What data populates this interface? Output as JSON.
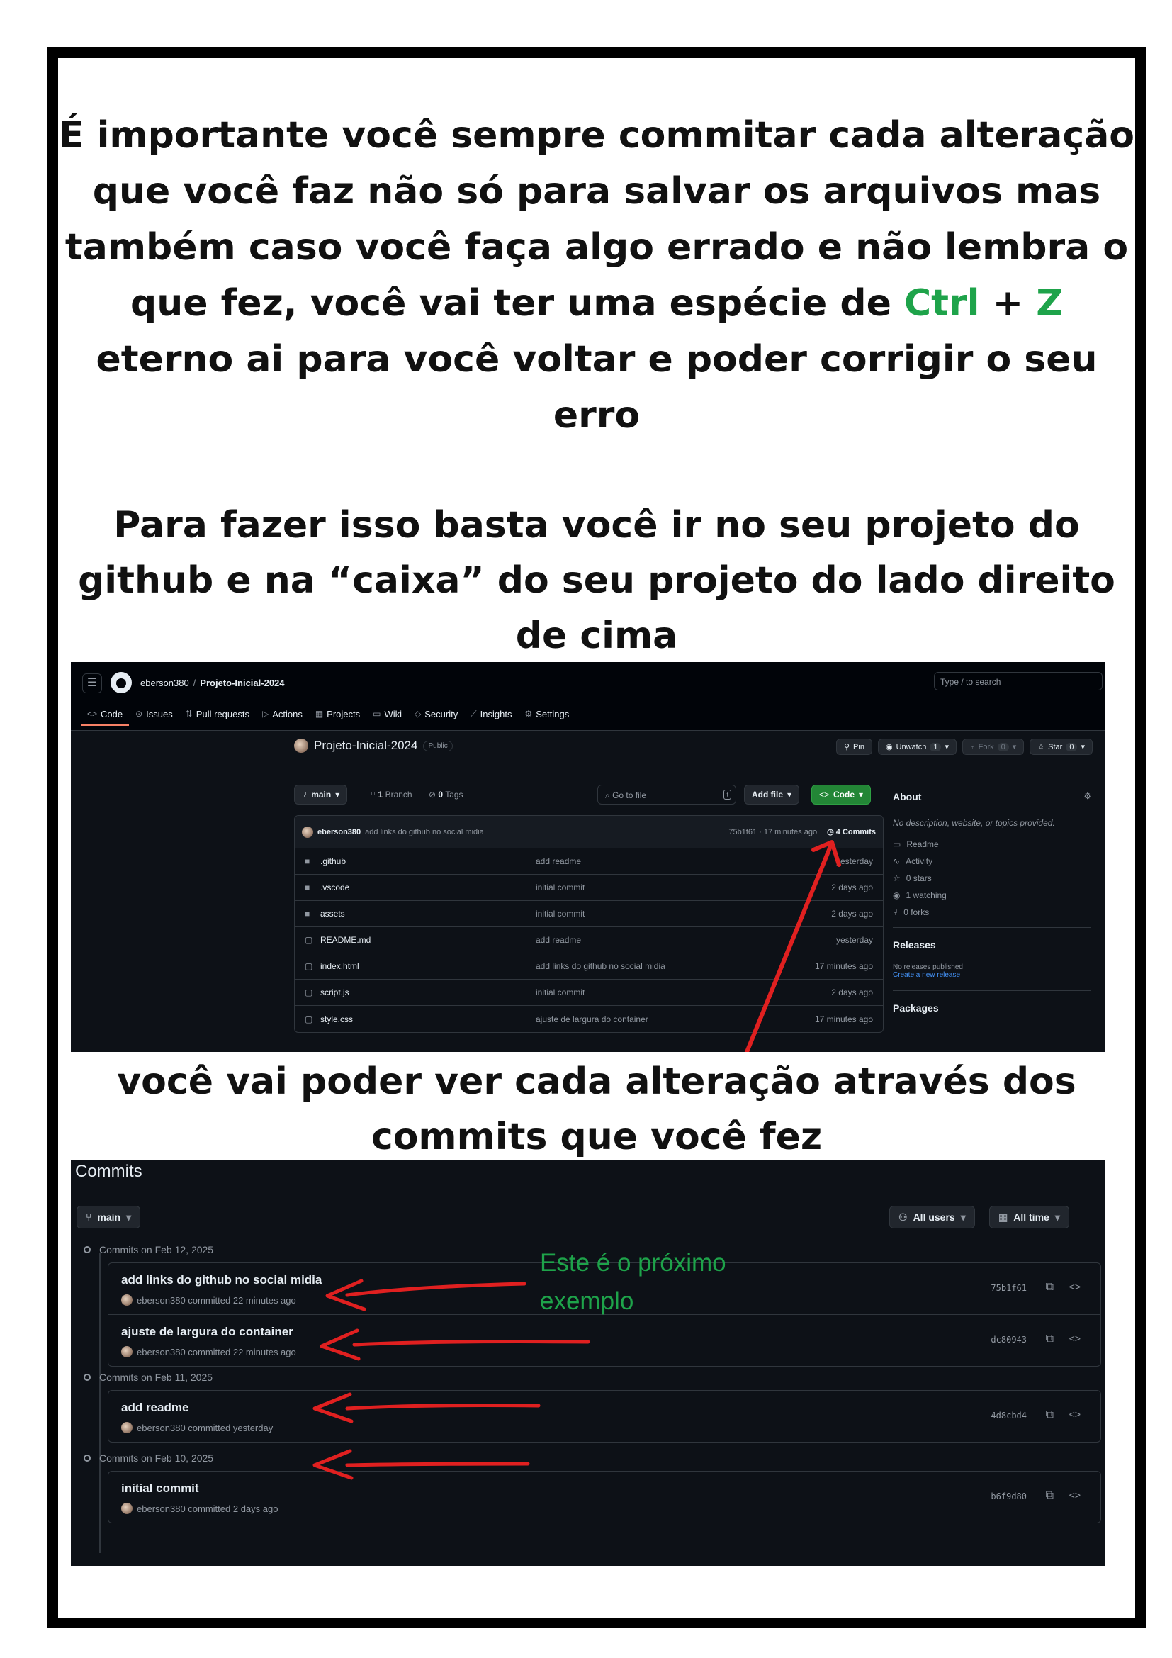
{
  "paragraph1": {
    "before": "É importante você sempre commitar cada alteração que você faz não só para salvar os arquivos mas também caso você faça algo errado e não lembra o que fez, você vai ter uma espécie de ",
    "ctrl": "Ctrl",
    "plus": " + ",
    "z": "Z",
    "after": " eterno ai para você voltar e poder corrigir o seu erro"
  },
  "paragraph2": "Para fazer isso basta você ir no seu projeto do github e na “caixa” do seu projeto do lado direito de cima",
  "paragraph3": "você vai poder ver cada alteração através dos commits que você fez",
  "colors": {
    "highlight_green": "#1ea34a",
    "arrow_red": "#e02020"
  },
  "repo_page": {
    "owner": "eberson380",
    "separator": "/",
    "repo": "Projeto-Inicial-2024",
    "search_placeholder": "Type / to search",
    "tabs": [
      {
        "icon": "code-icon",
        "glyph": "<>",
        "label": "Code"
      },
      {
        "icon": "issue-icon",
        "glyph": "⊙",
        "label": "Issues"
      },
      {
        "icon": "pull-request-icon",
        "glyph": "⇅",
        "label": "Pull requests"
      },
      {
        "icon": "play-icon",
        "glyph": "▷",
        "label": "Actions"
      },
      {
        "icon": "table-icon",
        "glyph": "▦",
        "label": "Projects"
      },
      {
        "icon": "book-icon",
        "glyph": "▭",
        "label": "Wiki"
      },
      {
        "icon": "shield-icon",
        "glyph": "◇",
        "label": "Security"
      },
      {
        "icon": "graph-icon",
        "glyph": "⟋",
        "label": "Insights"
      },
      {
        "icon": "gear-icon",
        "glyph": "⚙",
        "label": "Settings"
      }
    ],
    "repo_title": "Projeto-Inicial-2024",
    "visibility": "Public",
    "pin": "Pin",
    "unwatch": "Unwatch",
    "unwatch_count": "1",
    "fork": "Fork",
    "fork_count": "0",
    "star": "Star",
    "star_count": "0",
    "branch_button": "main",
    "branch_count": "1",
    "branch_label": "Branch",
    "tag_count": "0",
    "tag_label": "Tags",
    "go_to_file": "Go to file",
    "go_to_file_key": "t",
    "add_file": "Add file",
    "code_button": "Code",
    "latest_commit": {
      "user": "eberson380",
      "message": "add links do github no social midia",
      "hash_time": "75b1f61 · 17 minutes ago",
      "commits_count": "4",
      "commits_label": "Commits"
    },
    "files": [
      {
        "type": "dir",
        "name": ".github",
        "commit": "add readme",
        "time": "yesterday"
      },
      {
        "type": "dir",
        "name": ".vscode",
        "commit": "initial commit",
        "time": "2 days ago"
      },
      {
        "type": "dir",
        "name": "assets",
        "commit": "initial commit",
        "time": "2 days ago"
      },
      {
        "type": "file",
        "name": "README.md",
        "commit": "add readme",
        "time": "yesterday"
      },
      {
        "type": "file",
        "name": "index.html",
        "commit": "add links do github no social midia",
        "time": "17 minutes ago"
      },
      {
        "type": "file",
        "name": "script.js",
        "commit": "initial commit",
        "time": "2 days ago"
      },
      {
        "type": "file",
        "name": "style.css",
        "commit": "ajuste de largura do container",
        "time": "17 minutes ago"
      }
    ],
    "about": {
      "title": "About",
      "description": "No description, website, or topics provided.",
      "items": [
        {
          "icon": "book-icon",
          "label": "Readme"
        },
        {
          "icon": "pulse-icon",
          "label": "Activity"
        },
        {
          "icon": "star-icon",
          "label": "0 stars"
        },
        {
          "icon": "eye-icon",
          "label": "1 watching"
        },
        {
          "icon": "fork-icon",
          "label": "0 forks"
        }
      ],
      "releases_title": "Releases",
      "no_releases": "No releases published",
      "create_release": "Create a new release",
      "packages_title": "Packages"
    }
  },
  "commits_page": {
    "title": "Commits",
    "branch": "main",
    "all_users": "All users",
    "all_time": "All time",
    "note": "Este é o próximo exemplo",
    "groups": [
      {
        "date": "Commits on Feb 12, 2025",
        "commits": [
          {
            "message": "add links do github no social midia",
            "meta": "eberson380 committed 22 minutes ago",
            "hash": "75b1f61"
          },
          {
            "message": "ajuste de largura do container",
            "meta": "eberson380 committed 22 minutes ago",
            "hash": "dc80943"
          }
        ]
      },
      {
        "date": "Commits on Feb 11, 2025",
        "commits": [
          {
            "message": "add readme",
            "meta": "eberson380 committed yesterday",
            "hash": "4d8cbd4"
          }
        ]
      },
      {
        "date": "Commits on Feb 10, 2025",
        "commits": [
          {
            "message": "initial commit",
            "meta": "eberson380 committed 2 days ago",
            "hash": "b6f9d80"
          }
        ]
      }
    ]
  }
}
